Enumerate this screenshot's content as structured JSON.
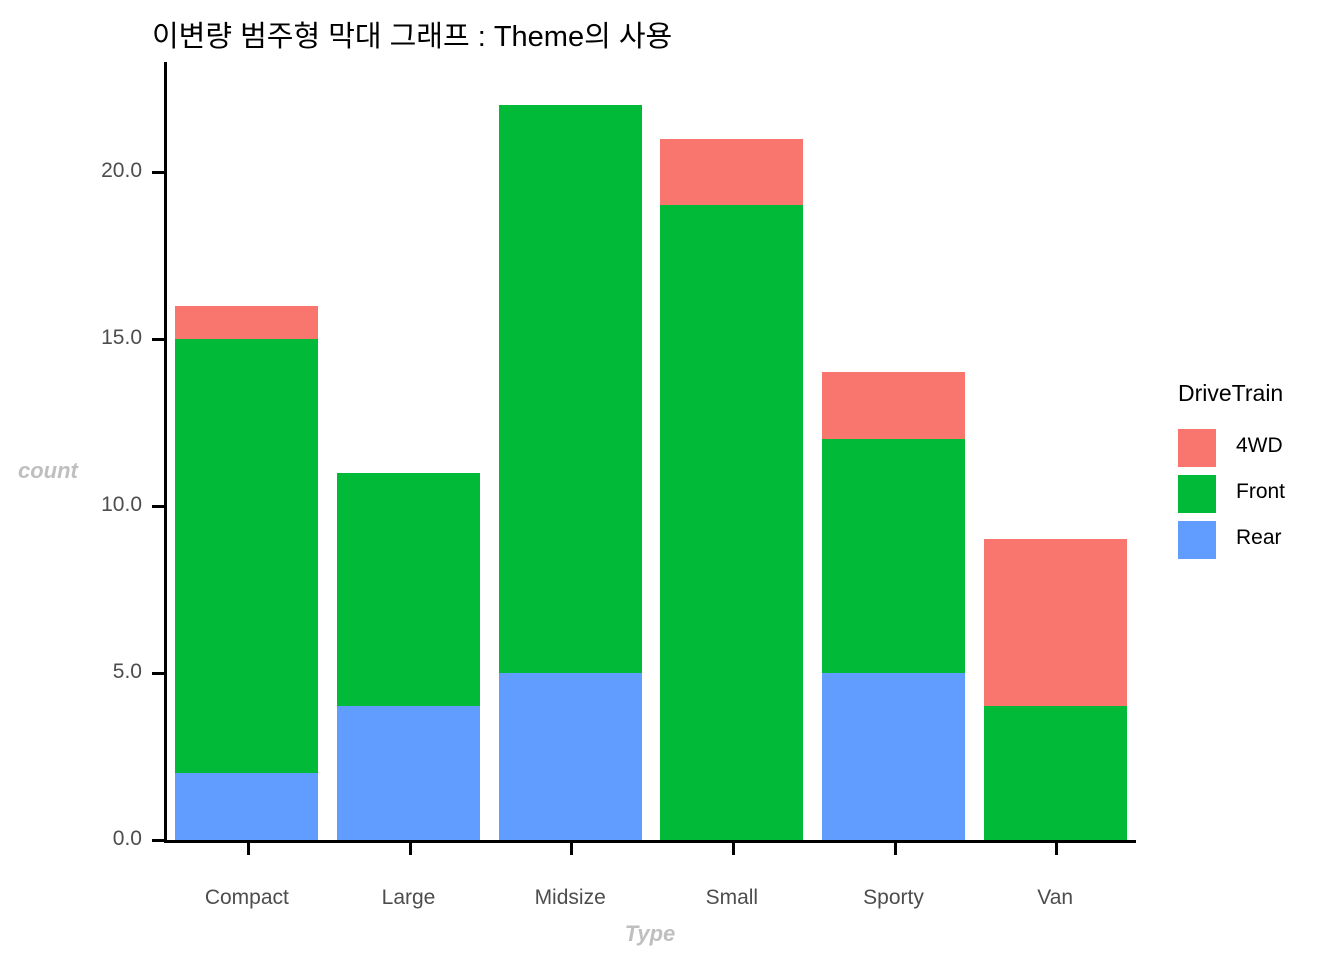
{
  "chart_data": {
    "type": "bar",
    "subtype": "stacked",
    "title": "이변량 범주형 막대 그래프 : Theme의 사용",
    "xlabel": "Type",
    "ylabel": "count",
    "categories": [
      "Compact",
      "Large",
      "Midsize",
      "Small",
      "Sporty",
      "Van"
    ],
    "series": [
      {
        "name": "4WD",
        "color": "#f8766d",
        "values": [
          1,
          0,
          0,
          2,
          2,
          5
        ]
      },
      {
        "name": "Front",
        "color": "#00ba38",
        "values": [
          13,
          7,
          17,
          19,
          7,
          4
        ]
      },
      {
        "name": "Rear",
        "color": "#619cff",
        "values": [
          2,
          4,
          5,
          0,
          5,
          0
        ]
      }
    ],
    "stack_order_bottom_to_top": [
      "Rear",
      "Front",
      "4WD"
    ],
    "totals": [
      16,
      11,
      22,
      21,
      14,
      9
    ],
    "ylim": [
      0,
      22.5
    ],
    "yticks": [
      0,
      5,
      10,
      15,
      20
    ],
    "ytick_labels": [
      "0.0",
      "5.0",
      "10.0",
      "15.0",
      "20.0"
    ],
    "grid": false,
    "legend_position": "right",
    "legend_title": "DriveTrain",
    "panel_background": "#ffffff",
    "axis_color": "#000000",
    "tick_label_color": "#4d4d4d",
    "axis_title_color": "#bfbfbf"
  },
  "legend": {
    "title": "DriveTrain",
    "items": [
      {
        "label": "4WD",
        "color": "#f8766d"
      },
      {
        "label": "Front",
        "color": "#00ba38"
      },
      {
        "label": "Rear",
        "color": "#619cff"
      }
    ]
  }
}
